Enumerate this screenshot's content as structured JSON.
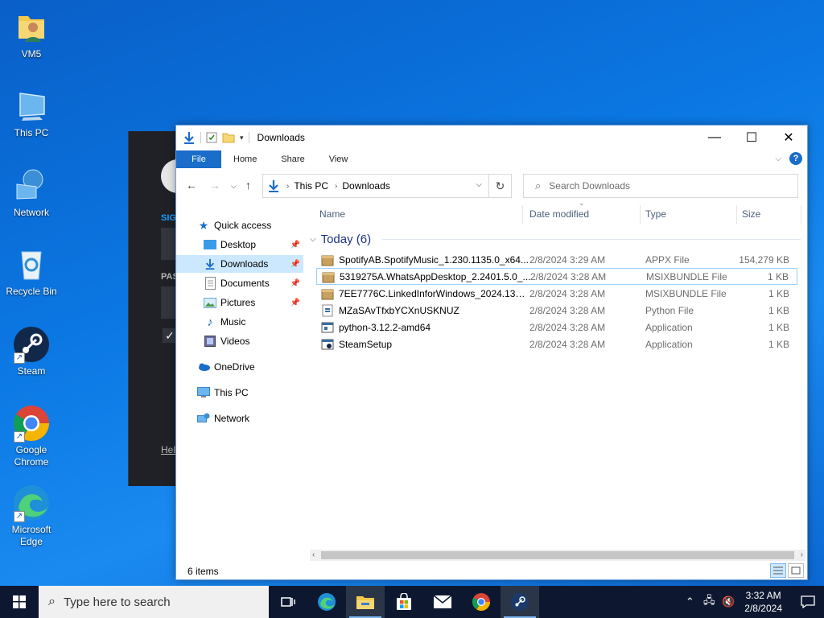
{
  "desktop": {
    "icons": [
      {
        "label": "VM5"
      },
      {
        "label": "This PC"
      },
      {
        "label": "Network"
      },
      {
        "label": "Recycle Bin"
      },
      {
        "label": "Steam"
      },
      {
        "label": "Google Chrome"
      },
      {
        "label": "Microsoft Edge"
      }
    ]
  },
  "steam_login": {
    "sign_label": "SIG",
    "pass_label": "PAS",
    "help_label": "Hel"
  },
  "explorer": {
    "title": "Downloads",
    "ribbon_tabs": [
      "File",
      "Home",
      "Share",
      "View"
    ],
    "address": {
      "crumbs": [
        "This PC",
        "Downloads"
      ]
    },
    "search_placeholder": "Search Downloads",
    "nav": {
      "quick_access": "Quick access",
      "items": [
        "Desktop",
        "Downloads",
        "Documents",
        "Pictures",
        "Music",
        "Videos"
      ],
      "onedrive": "OneDrive",
      "this_pc": "This PC",
      "network": "Network"
    },
    "columns": [
      "Name",
      "Date modified",
      "Type",
      "Size"
    ],
    "group": "Today (6)",
    "files": [
      {
        "name": "SpotifyAB.SpotifyMusic_1.230.1135.0_x64...",
        "date": "2/8/2024 3:29 AM",
        "type": "APPX File",
        "size": "154,279 KB"
      },
      {
        "name": "5319275A.WhatsAppDesktop_2.2401.5.0_...",
        "date": "2/8/2024 3:28 AM",
        "type": "MSIXBUNDLE File",
        "size": "1 KB"
      },
      {
        "name": "7EE7776C.LinkedInforWindows_2024.131....",
        "date": "2/8/2024 3:28 AM",
        "type": "MSIXBUNDLE File",
        "size": "1 KB"
      },
      {
        "name": "MZaSAvTfxbYCXnUSKNUZ",
        "date": "2/8/2024 3:28 AM",
        "type": "Python File",
        "size": "1 KB"
      },
      {
        "name": "python-3.12.2-amd64",
        "date": "2/8/2024 3:28 AM",
        "type": "Application",
        "size": "1 KB"
      },
      {
        "name": "SteamSetup",
        "date": "2/8/2024 3:28 AM",
        "type": "Application",
        "size": "1 KB"
      }
    ],
    "status": "6 items"
  },
  "taskbar": {
    "search_placeholder": "Type here to search",
    "time": "3:32 AM",
    "date": "2/8/2024"
  }
}
